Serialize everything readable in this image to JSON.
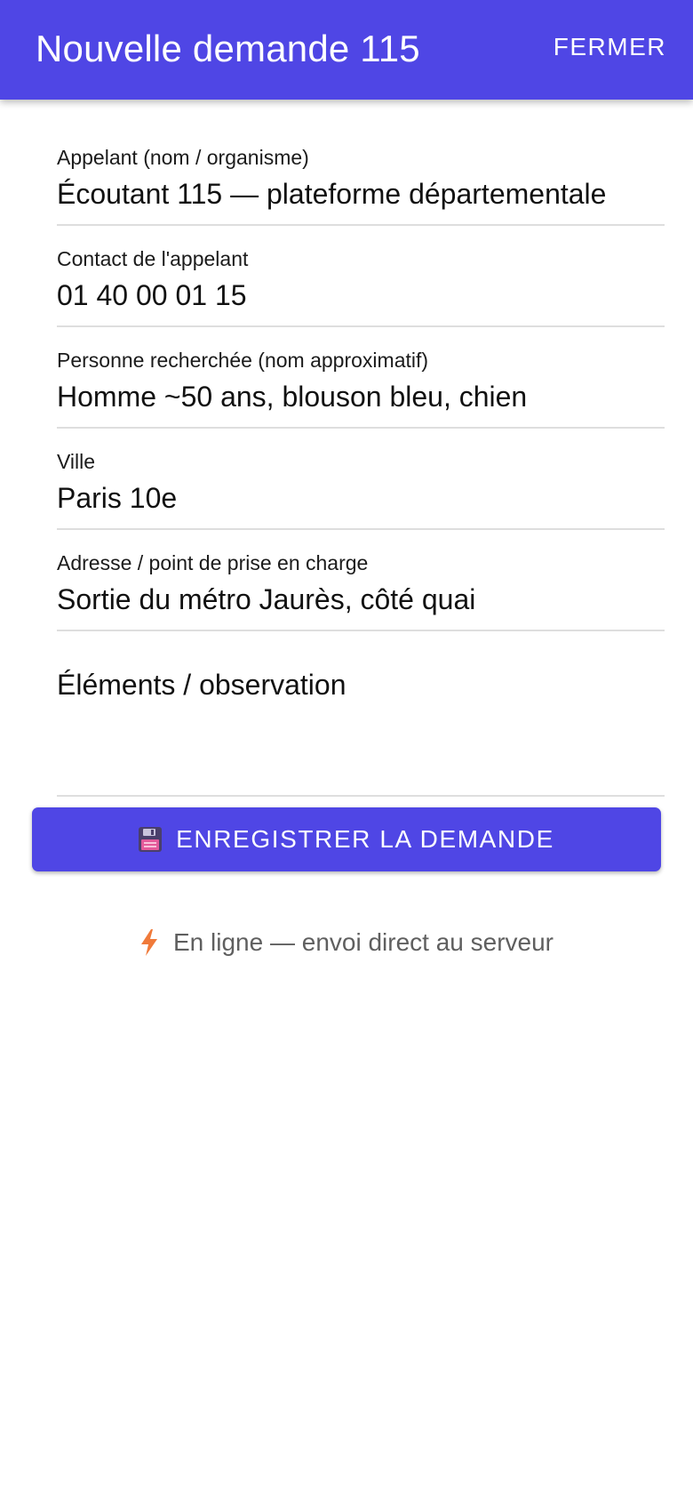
{
  "header": {
    "title": "Nouvelle demande 115",
    "close_label": "FERMER"
  },
  "form": {
    "fields": [
      {
        "label": "Appelant (nom / organisme)",
        "value": "Écoutant 115 — plateforme départementale"
      },
      {
        "label": "Contact de l'appelant",
        "value": "01 40 00 01 15"
      },
      {
        "label": "Personne recherchée (nom approximatif)",
        "value": "Homme ~50 ans, blouson bleu, chien"
      },
      {
        "label": "Ville",
        "value": "Paris 10e"
      },
      {
        "label": "Adresse / point de prise en charge",
        "value": "Sortie du métro Jaurès, côté quai"
      }
    ],
    "observation_placeholder": "Éléments / observation"
  },
  "actions": {
    "save_label": "ENREGISTRER LA DEMANDE",
    "save_icon": "floppy-disk-icon"
  },
  "status": {
    "icon": "lightning-bolt-icon",
    "text": "En ligne — envoi direct au serveur"
  },
  "colors": {
    "primary": "#4f46e5",
    "bolt": "#f07a3a"
  }
}
